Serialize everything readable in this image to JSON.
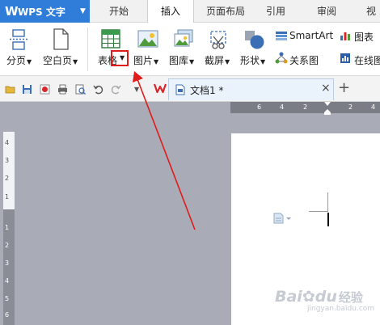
{
  "app": {
    "logo": "W",
    "name": "WPS 文字"
  },
  "tabs": [
    {
      "label": "开始"
    },
    {
      "label": "插入"
    },
    {
      "label": "页面布局"
    },
    {
      "label": "引用"
    },
    {
      "label": "审阅"
    },
    {
      "label": "视"
    }
  ],
  "active_tab": "插入",
  "ribbon": {
    "page_break": "分页",
    "blank_page": "空白页",
    "table": "表格",
    "picture": "图片",
    "gallery": "图库",
    "screenshot": "截屏",
    "shapes": "形状",
    "smartart": "SmartArt",
    "chart": "图表",
    "relation": "关系图",
    "online_chart": "在线图"
  },
  "document_tab": {
    "title": "文档1 *",
    "close": "×",
    "new_tab": "+"
  },
  "hruler_ticks": [
    "6",
    "4",
    "2",
    "2",
    "4"
  ],
  "vruler_ticks": [
    "4",
    "3",
    "2",
    "1",
    "1",
    "2",
    "3",
    "4",
    "5",
    "6"
  ],
  "watermark": {
    "brand": "Bai",
    "paw": "du",
    "suffix": "经验",
    "url": "jingyan.baidu.com"
  },
  "colors": {
    "app_blue": "#2f7dd8",
    "annotation_red": "#e01b1b",
    "wps_red": "#d9262b"
  }
}
